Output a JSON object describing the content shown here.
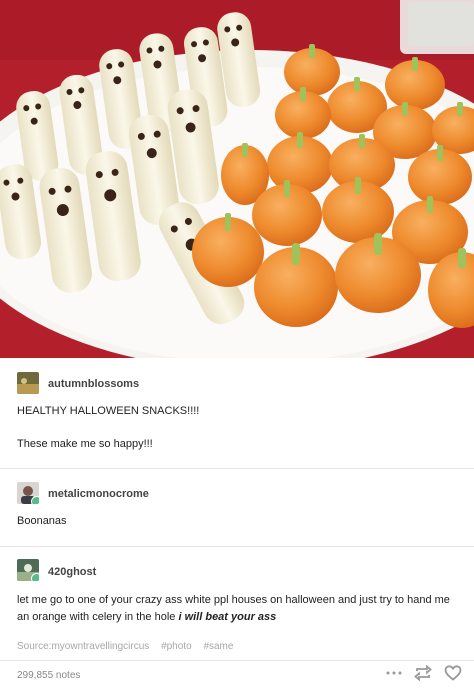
{
  "post": {
    "image_alt": "Banana ghosts and clementine pumpkins on a white platter",
    "comments": [
      {
        "username": "autumnblossoms",
        "lines": [
          "HEALTHY HALLOWEEN SNACKS!!!!",
          "These make me so happy!!!"
        ]
      },
      {
        "username": "metalicmonocrome",
        "lines": [
          "Boonanas"
        ]
      },
      {
        "username": "420ghost",
        "text": "let me go to one of your crazy ass white ppl houses on halloween and just try to hand me an orange with celery in the hole",
        "emphasis": "i will beat your ass"
      }
    ],
    "source_label": "Source:",
    "source_name": "myowntravellingcircus",
    "tags": [
      "#photo",
      "#same"
    ],
    "notes": "299,855 notes"
  },
  "icons": {
    "more": "more-dots-icon",
    "reblog": "reblog-icon",
    "like": "heart-icon"
  },
  "colors": {
    "follow_badge": "#56bc8a",
    "tablecloth": "#b3202b",
    "orange": "#ef8a2c"
  }
}
